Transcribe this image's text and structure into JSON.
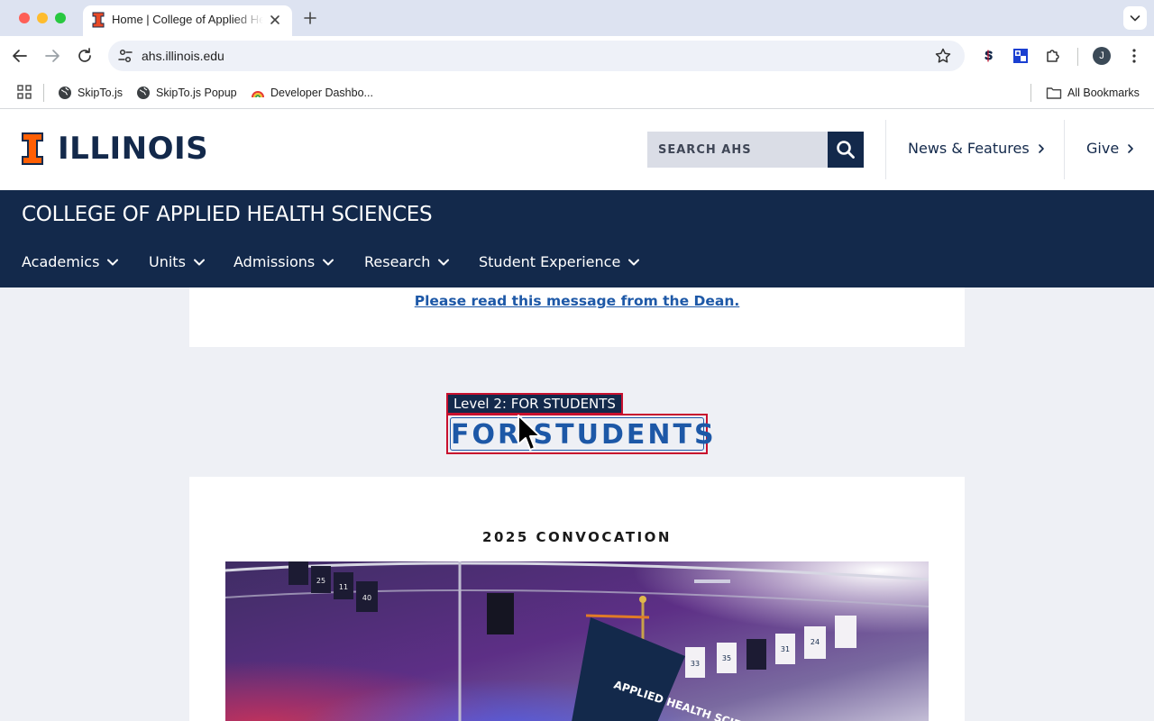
{
  "browser": {
    "tab_title": "Home | College of Applied Health Sciences",
    "url": "ahs.illinois.edu",
    "bookmarks": [
      {
        "label": "SkipTo.js",
        "icon": "globe-icon"
      },
      {
        "label": "SkipTo.js Popup",
        "icon": "globe-icon"
      },
      {
        "label": "Developer Dashbo...",
        "icon": "rainbow-icon"
      }
    ],
    "all_bookmarks_label": "All Bookmarks",
    "profile_initial": "J"
  },
  "header": {
    "logo_text": "ILLINOIS",
    "search_placeholder": "SEARCH AHS",
    "utility_links": [
      "News & Features",
      "Give"
    ]
  },
  "nav": {
    "unit_title": "COLLEGE OF APPLIED HEALTH SCIENCES",
    "items": [
      "Academics",
      "Units",
      "Admissions",
      "Research",
      "Student Experience"
    ]
  },
  "notice": {
    "link_text": "Please read this message from the Dean."
  },
  "section": {
    "level_badge": "Level 2: FOR STUDENTS",
    "heading": "FOR STUDENTS"
  },
  "card": {
    "title": "2025 CONVOCATION",
    "banner_text": "APPLIED HEALTH SCIENCES",
    "jersey_numbers": [
      "25",
      "11",
      "40",
      "33",
      "35",
      "31",
      "24"
    ]
  },
  "colors": {
    "illinois_blue": "#13294b",
    "illinois_orange": "#ff5f05",
    "link_blue": "#1d58a7",
    "focus_red": "#c8102e"
  }
}
